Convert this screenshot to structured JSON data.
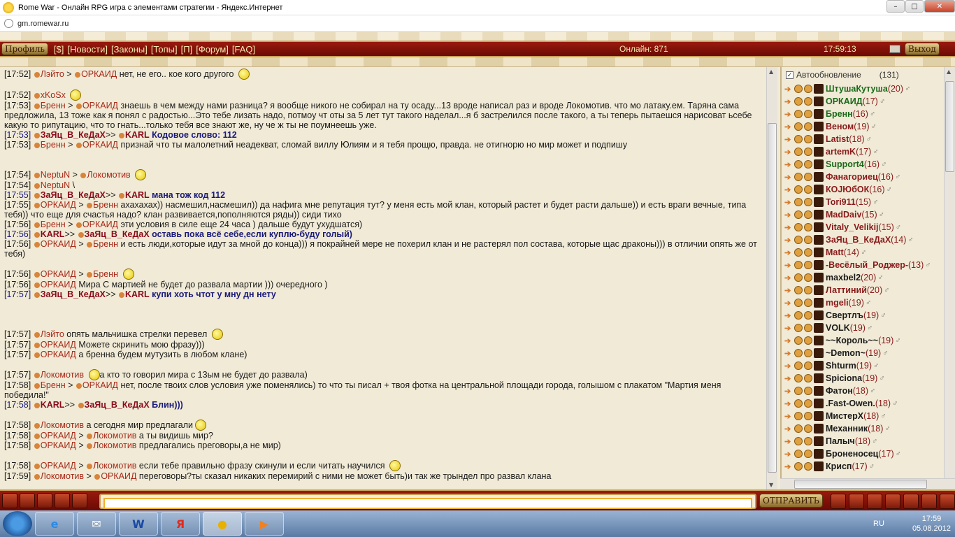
{
  "window": {
    "title": "Rome War - Онлайн RPG игра с элементами стратегии - Яндекс.Интернет",
    "url": "gm.romewar.ru"
  },
  "nav": {
    "profile": "Профиль",
    "links": [
      "[$]",
      "[Новости]",
      "[Законы]",
      "[Топы]",
      "[П]",
      "[Форум]",
      "[FAQ]"
    ],
    "online": "Онлайн: 871",
    "time": "17:59:13",
    "exit": "Выход"
  },
  "chat": [
    {
      "t": "[17:52]",
      "html": "<span class='dot'></span><span class='n'>Лэйто</span> &gt; <span class='dot'></span><span class='n'>ОРКАИД</span> нет, не его.. кое кого другого <span class='smile'></span>"
    },
    {
      "t": "",
      "html": ""
    },
    {
      "t": "[17:52]",
      "html": "<span class='dot'></span><span class='n'>xKoSx</span> <span class='smile'></span>"
    },
    {
      "t": "[17:53]",
      "html": "<span class='dot'></span><span class='n'>Бренн</span> &gt; <span class='dot'></span><span class='n'>ОРКАИД</span> знаешь в чем между нами разница? я вообще никого не собирал на ту осаду...13  вроде написал раз и вроде Локомотив. что мо латаку.ем. Таряна сама предложила,  13 тоже как я понял с радостью...Это тебе лизать надо, потмоу чт оты за 5 лет  тут такого наделал...я б застрелился после такого, а ты теперь пытаешся  нарисоват ьсебе какую то рипутацию, что то гнать...только тебя все знают же, ну  че ж ты не поумнеешь уже."
    },
    {
      "t": "[17:53]",
      "bold": true,
      "html": "<span class='dot'></span><span class='nb'>ЗаЯц_В_КеДаХ</span>&gt;&gt; <span class='dot'></span><span class='nb'>KARL</span>  <span class='b'>Кодовое слово: 112</span>"
    },
    {
      "t": "[17:53]",
      "html": "<span class='dot'></span><span class='n'>Бренн</span> &gt; <span class='dot'></span><span class='n'>ОРКАИД</span> признай что ты малолетний неадекват, сломай виллу Юлиям и я тебя прощю, правда.  не отигнорю но мир может и подпишу"
    },
    {
      "t": "",
      "html": ""
    },
    {
      "t": "",
      "html": ""
    },
    {
      "t": "[17:54]",
      "html": "<span class='dot'></span><span class='n'>NeptuN</span> &gt; <span class='dot'></span><span class='n'>Локомотив</span> <span class='smile'></span>"
    },
    {
      "t": "[17:54]",
      "html": "<span class='dot'></span><span class='n'>NeptuN</span>  \\"
    },
    {
      "t": "[17:55]",
      "bold": true,
      "html": "<span class='dot'></span><span class='nb'>ЗаЯц_В_КеДаХ</span>&gt;&gt; <span class='dot'></span><span class='nb'>KARL</span>  <span class='b'>мана тож код 112</span>"
    },
    {
      "t": "[17:55]",
      "html": "<span class='dot'></span><span class='n'>ОРКАИД</span> &gt; <span class='dot'></span><span class='n'>Бренн</span> ахахахах)) насмешил,насмешил)) да нафига мне репутация тут? у меня есть мой  клан, который растет и будет расти дальше)) и есть враги вечные, типа тебя)) что   еще для счастья надо? клан развивается,пополняются ряды)) сиди тихо"
    },
    {
      "t": "[17:56]",
      "html": "<span class='dot'></span><span class='n'>Бренн</span> &gt; <span class='dot'></span><span class='n'>ОРКАИД</span> эти условия в силе еще 24 часа ) дальше будут ухудшатся)"
    },
    {
      "t": "[17:56]",
      "bold": true,
      "html": "<span class='dot'></span><span class='nb'>KARL</span>&gt;&gt; <span class='dot'></span><span class='nb'>ЗаЯц_В_КеДаХ</span>  <span class='b'>оставь пока всё себе,если куплю-буду голый)</span>"
    },
    {
      "t": "[17:56]",
      "html": "<span class='dot'></span><span class='n'>ОРКАИД</span> &gt; <span class='dot'></span><span class='n'>Бренн</span> и есть люди,которые идут за мной до конца))) я покрайней мере не похерил клан и  не растерял пол состава, которые щас драконы))) в отличии опять же от тебя)"
    },
    {
      "t": "",
      "html": ""
    },
    {
      "t": "[17:56]",
      "html": "<span class='dot'></span><span class='n'>ОРКАИД</span> &gt; <span class='dot'></span><span class='n'>Бренн</span> <span class='smile'></span>"
    },
    {
      "t": "[17:56]",
      "html": "<span class='dot'></span><span class='n'>ОРКАИД</span>  Мира С мартией не будет до развала мартии ))) очередного )"
    },
    {
      "t": "[17:57]",
      "bold": true,
      "html": "<span class='dot'></span><span class='nb'>ЗаЯц_В_КеДаХ</span>&gt;&gt; <span class='dot'></span><span class='nb'>KARL</span>  <span class='b'>купи хоть чтот у мну дн нету</span>"
    },
    {
      "t": "",
      "html": ""
    },
    {
      "t": "",
      "html": ""
    },
    {
      "t": "",
      "html": ""
    },
    {
      "t": "[17:57]",
      "html": "<span class='dot'></span><span class='n'>Лэйто</span>  опять мальчишка стрелки перевел <span class='smile'></span>"
    },
    {
      "t": "[17:57]",
      "html": "<span class='dot'></span><span class='n'>ОРКАИД</span>  Можете скринить мою фразу)))"
    },
    {
      "t": "[17:57]",
      "html": "<span class='dot'></span><span class='n'>ОРКАИД</span>  а бренна будем мутузить в любом клане)"
    },
    {
      "t": "",
      "html": ""
    },
    {
      "t": "[17:57]",
      "html": "<span class='dot'></span><span class='n'>Локомотив</span>  <span class='smile'></span>а кто то говорил мира с 13ым не будет до развала)"
    },
    {
      "t": "[17:58]",
      "html": "<span class='dot'></span><span class='n'>Бренн</span> &gt; <span class='dot'></span><span class='n'>ОРКАИД</span> нет, после твоих слов условия уже поменялись) то что ты писал + твоя фотка на  центральной площади города, голышом с плакатом \"Мартия меня победила!\""
    },
    {
      "t": "[17:58]",
      "bold": true,
      "html": "<span class='dot'></span><span class='nb'>KARL</span>&gt;&gt; <span class='dot'></span><span class='nb'>ЗаЯц_В_КеДаХ</span>  <span class='b'>Блин)))</span>"
    },
    {
      "t": "",
      "html": ""
    },
    {
      "t": "[17:58]",
      "html": "<span class='dot'></span><span class='n'>Локомотив</span>  а сегодня мир предлагали<span class='smile'></span>"
    },
    {
      "t": "[17:58]",
      "html": "<span class='dot'></span><span class='n'>ОРКАИД</span> &gt; <span class='dot'></span><span class='n'>Локомотив</span> а ты видишь мир?"
    },
    {
      "t": "[17:58]",
      "html": "<span class='dot'></span><span class='n'>ОРКАИД</span> &gt; <span class='dot'></span><span class='n'>Локомотив</span> предлагались преговоры,а не мир)"
    },
    {
      "t": "",
      "html": ""
    },
    {
      "t": "[17:58]",
      "html": "<span class='dot'></span><span class='n'>ОРКАИД</span> &gt; <span class='dot'></span><span class='n'>Локомотив</span> если тебе правильно фразу скинули и если читать научился <span class='smile'></span>"
    },
    {
      "t": "[17:59]",
      "html": "<span class='dot'></span><span class='n'>Локомотив</span> &gt; <span class='dot'></span><span class='n'>ОРКАИД</span> переговоры?ты сказал никаких перемирий с ними не может быть)и так же трындел  про развал клана"
    }
  ],
  "users": {
    "autoupdate": "Автообновление",
    "count": "(131)",
    "list": [
      {
        "name": "ШтушаКутуша",
        "lvl": "(20)",
        "c": "uname"
      },
      {
        "name": "ОРКАИД",
        "lvl": "(17)",
        "c": "uname"
      },
      {
        "name": "Бренн",
        "lvl": "(16)",
        "c": "uname"
      },
      {
        "name": "Веном",
        "lvl": "(19)",
        "c": "uname red"
      },
      {
        "name": "Latist",
        "lvl": "(18)",
        "c": "uname red"
      },
      {
        "name": "artemK",
        "lvl": "(17)",
        "c": "uname red"
      },
      {
        "name": "Support4",
        "lvl": "(16)",
        "c": "uname"
      },
      {
        "name": "Фанагориец",
        "lvl": "(16)",
        "c": "uname red"
      },
      {
        "name": "КОЈЮбОК",
        "lvl": "(16)",
        "c": "uname red"
      },
      {
        "name": "Tori911",
        "lvl": "(15)",
        "c": "uname red"
      },
      {
        "name": "MadDaiv",
        "lvl": "(15)",
        "c": "uname red"
      },
      {
        "name": "Vitaly_Velikij",
        "lvl": "(15)",
        "c": "uname red"
      },
      {
        "name": "ЗаЯц_В_КеДаХ",
        "lvl": "(14)",
        "c": "uname red"
      },
      {
        "name": "Matt",
        "lvl": "(14)",
        "c": "uname red"
      },
      {
        "name": "-Весёлый_Роджер-",
        "lvl": "(13)",
        "c": "uname red"
      },
      {
        "name": "maxbel2",
        "lvl": "(20)",
        "c": "uname dk"
      },
      {
        "name": "Латтиний",
        "lvl": "(20)",
        "c": "uname red"
      },
      {
        "name": "mgeli",
        "lvl": "(19)",
        "c": "uname red"
      },
      {
        "name": "Свертлъ",
        "lvl": "(19)",
        "c": "uname dk"
      },
      {
        "name": "VOLK",
        "lvl": "(19)",
        "c": "uname dk"
      },
      {
        "name": "~~Король~~",
        "lvl": "(19)",
        "c": "uname dk"
      },
      {
        "name": "~Demon~",
        "lvl": "(19)",
        "c": "uname dk"
      },
      {
        "name": "Shturm",
        "lvl": "(19)",
        "c": "uname dk"
      },
      {
        "name": "Spiciona",
        "lvl": "(19)",
        "c": "uname dk"
      },
      {
        "name": "Фатон",
        "lvl": "(18)",
        "c": "uname dk"
      },
      {
        "name": ".Fast-Owen.",
        "lvl": "(18)",
        "c": "uname dk"
      },
      {
        "name": "МистерХ",
        "lvl": "(18)",
        "c": "uname dk"
      },
      {
        "name": "Механник",
        "lvl": "(18)",
        "c": "uname dk"
      },
      {
        "name": "Палыч",
        "lvl": "(18)",
        "c": "uname dk"
      },
      {
        "name": "Броненосец",
        "lvl": "(17)",
        "c": "uname dk"
      },
      {
        "name": "Крисп",
        "lvl": "(17)",
        "c": "uname dk"
      }
    ]
  },
  "bottom": {
    "send": "ОТПРАВИТЬ"
  },
  "taskbar": {
    "lang": "RU",
    "time": "17:59",
    "date": "05.08.2012"
  }
}
